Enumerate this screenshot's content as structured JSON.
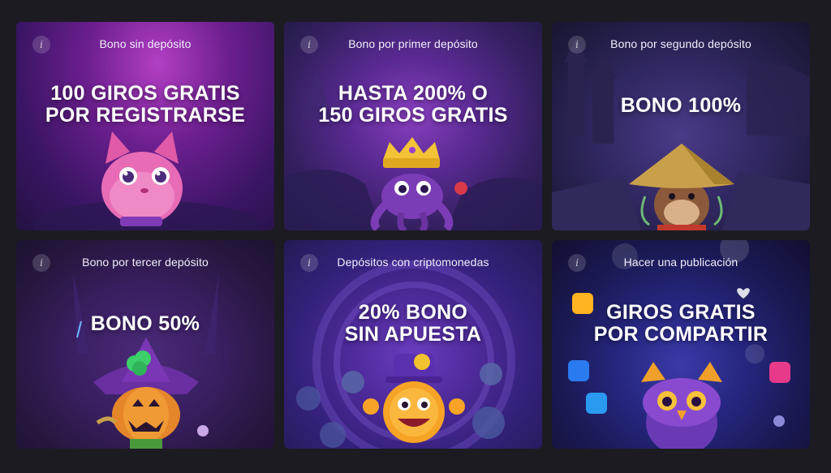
{
  "cards": [
    {
      "subtitle": "Bono sin depósito",
      "line1": "100 GIROS GRATIS",
      "line2": "POR REGISTRARSE",
      "icon": "info-icon",
      "art": "pink-cat"
    },
    {
      "subtitle": "Bono por primer depósito",
      "line1": "HASTA 200% O",
      "line2": "150 GIROS GRATIS",
      "icon": "info-icon",
      "art": "crowned-octopus"
    },
    {
      "subtitle": "Bono por segundo depósito",
      "line1": "BONO 100%",
      "line2": "",
      "icon": "info-icon",
      "art": "samurai-dog"
    },
    {
      "subtitle": "Bono por tercer depósito",
      "line1": "BONO 50%",
      "line2": "",
      "icon": "info-icon",
      "art": "pumpkin-witch"
    },
    {
      "subtitle": "Depósitos con criptomonedas",
      "line1": "20% BONO",
      "line2": "SIN APUESTA",
      "icon": "info-icon",
      "art": "coin-mascot"
    },
    {
      "subtitle": "Hacer una publicación",
      "line1": "GIROS GRATIS",
      "line2": "POR COMPARTIR",
      "icon": "info-icon",
      "art": "owl-social"
    }
  ],
  "info_glyph": "i",
  "colors": {
    "page_bg": "#1c1b22",
    "text": "#ffffff"
  }
}
